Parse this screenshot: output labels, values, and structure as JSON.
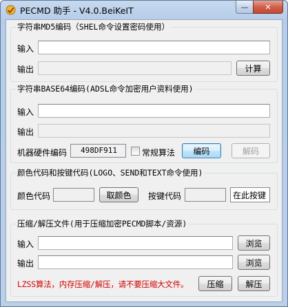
{
  "window": {
    "title": "PECMD 助手 - V4.0.BeiKeIT",
    "minimize_glyph": "—",
    "close_glyph": "✕"
  },
  "md5": {
    "group_label": "字符串MD5编码（SHEL命令设置密码使用）",
    "input_label": "输入",
    "input_value": "",
    "output_label": "输出",
    "output_value": "",
    "calc_button": "计算"
  },
  "base64": {
    "group_label": "字符串BASE64编码(ADSL命令加密用户资料使用)",
    "input_label": "输入",
    "input_value": "",
    "output_label": "输出",
    "output_value": "",
    "hw_label": "机器硬件编码",
    "hw_code": "498DF911",
    "normal_algo_label": "常规算法",
    "normal_algo_checked": false,
    "encode_button": "编码",
    "decode_button": "解码"
  },
  "keycode": {
    "group_label": "颜色代码和按键代码(LOGO、SEND和TEXT命令使用)",
    "color_label": "颜色代码",
    "color_value": "",
    "pick_color_button": "取颜色",
    "key_label": "按键代码",
    "key_value": "",
    "press_here": "在此按键"
  },
  "compress": {
    "group_label": "压缩/解压文件(用于压缩加密PECMD脚本/资源)",
    "input_label": "输入",
    "input_value": "",
    "output_label": "输出",
    "output_value": "",
    "browse_input_button": "浏览",
    "browse_output_button": "浏览",
    "warning": "LZSS算法，内存压缩/解压，请不要压缩大文件。",
    "compress_button": "压缩",
    "decompress_button": "解压"
  },
  "colors": {
    "warning": "#d00000",
    "titlebar": "#c6d9ef",
    "client": "#f0f0f0"
  }
}
